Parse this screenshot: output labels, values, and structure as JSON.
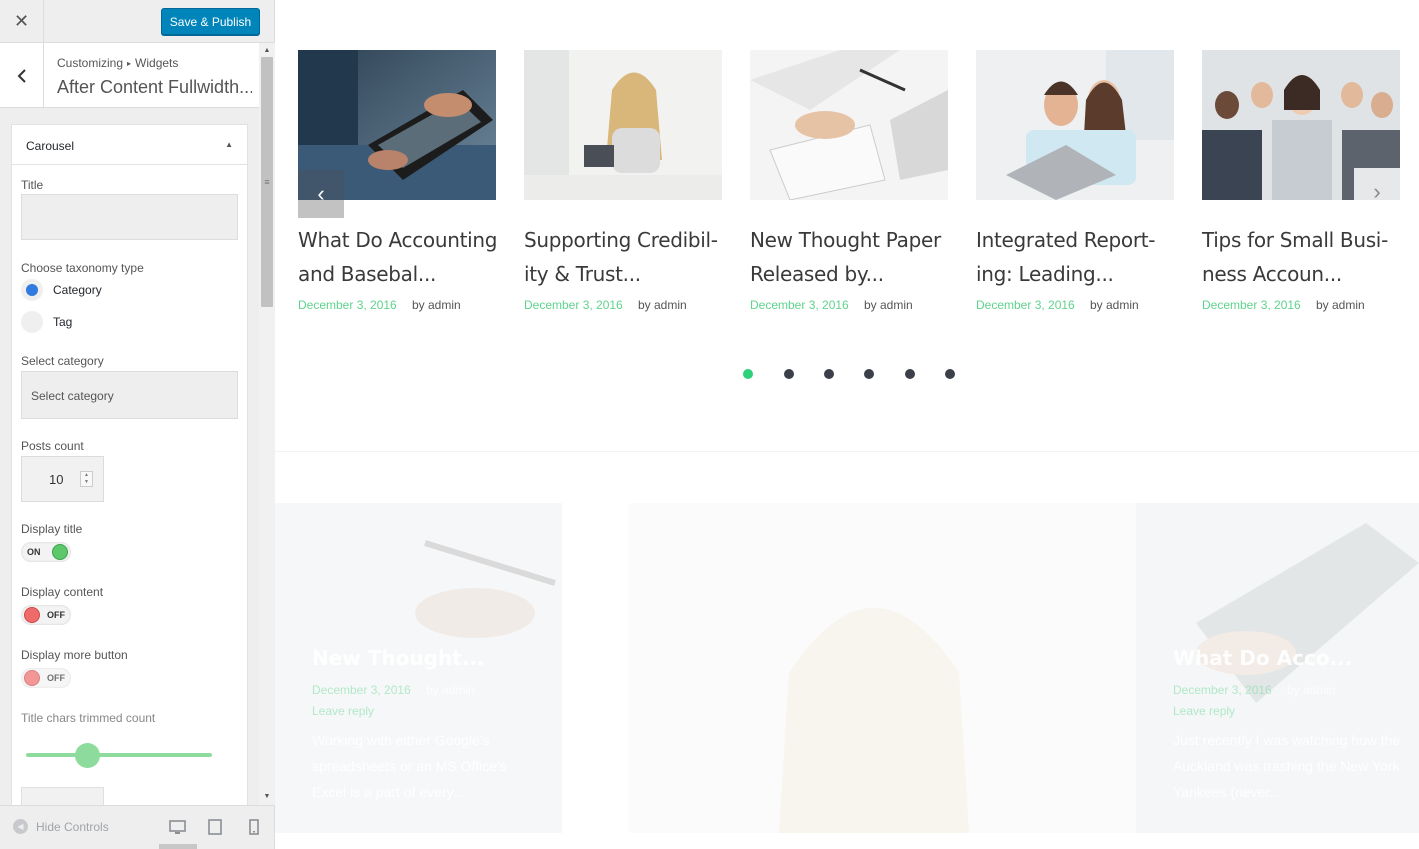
{
  "topbar": {
    "close_label": "✕",
    "publish_label": "Save & Publish"
  },
  "section": {
    "breadcrumb_parent": "Customizing",
    "breadcrumb_sep": "▸",
    "breadcrumb_child": "Widgets",
    "title": "After Content Fullwidth..."
  },
  "widget": {
    "name": "Carousel",
    "title_label": "Title",
    "title_value": "",
    "taxonomy_label": "Choose taxonomy type",
    "taxonomy_options": [
      "Category",
      "Tag"
    ],
    "taxonomy_selected": "Category",
    "select_category_label": "Select category",
    "select_category_value": "Select category",
    "posts_count_label": "Posts count",
    "posts_count_value": "10",
    "display_title_label": "Display title",
    "display_title_state": "ON",
    "display_content_label": "Display content",
    "display_content_state": "OFF",
    "display_more_label": "Display more button",
    "display_more_state": "OFF",
    "trim_label": "Title chars trimmed count",
    "trim_slider_fraction": 0.33
  },
  "footer": {
    "hide_controls_label": "Hide Controls"
  },
  "carousel": {
    "cards": [
      {
        "title": "What Do Accounting and Basebal...",
        "date": "December 3, 2016",
        "author": "by admin",
        "image": "tablet-hands-photo"
      },
      {
        "title": "Supporting Credibil-ity & Trust...",
        "title_lines": [
          "Supporting Credibil-",
          "ity & Trust..."
        ],
        "date": "December 3, 2016",
        "author": "by admin",
        "image": "woman-tablet-photo"
      },
      {
        "title": "New Thought Paper Released by...",
        "date": "December 3, 2016",
        "author": "by admin",
        "image": "calculator-photo"
      },
      {
        "title": "Integrated Report-ing: Leading...",
        "title_lines": [
          "Integrated Report-",
          "ing: Leading..."
        ],
        "date": "December 3, 2016",
        "author": "by admin",
        "image": "couple-laptop-photo"
      },
      {
        "title": "Tips for Small Busi-ness Accoun...",
        "title_lines": [
          "Tips for Small Busi-",
          "ness Accoun..."
        ],
        "date": "December 3, 2016",
        "author": "by admin",
        "image": "business-team-photo"
      }
    ],
    "dot_count": 6,
    "active_dot": 0
  },
  "lower_tiles": [
    {
      "title": "New Thought...",
      "date": "December 3, 2016",
      "author": "by admin",
      "extra": "Leave reply",
      "text": "Working with either Google's spreadsheets or an MS Office's Excel is a part of every..."
    },
    {
      "title": "",
      "date": "",
      "author": "",
      "extra": "",
      "text": ""
    },
    {
      "title": "What Do Acco...",
      "date": "December 3, 2016",
      "author": "by admin",
      "extra": "Leave reply",
      "text": "Just recently I was watching how the Auckland was trashing the New York Yankees (never..."
    }
  ],
  "colors": {
    "accent": "#0085ba",
    "green": "#5fd38d",
    "dot_active": "#2fd07a",
    "dot": "#3b3f4a"
  }
}
